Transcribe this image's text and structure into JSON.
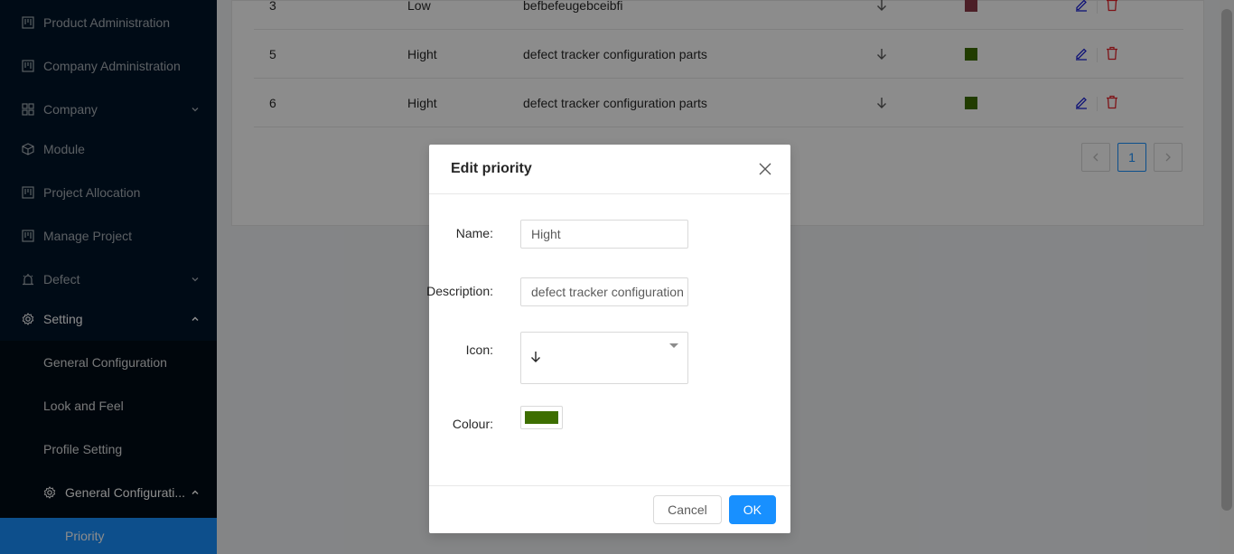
{
  "sidebar": {
    "items": [
      {
        "label": "Product Administration",
        "icon": "project-icon"
      },
      {
        "label": "Company Administration",
        "icon": "project-icon"
      },
      {
        "label": "Company",
        "icon": "appstore-icon",
        "expandable": true
      },
      {
        "label": "Module",
        "icon": "code-sandbox-icon"
      },
      {
        "label": "Project Allocation",
        "icon": "project-icon"
      },
      {
        "label": "Manage Project",
        "icon": "project-icon"
      },
      {
        "label": "Defect",
        "icon": "alert-icon",
        "expandable": true
      },
      {
        "label": "Setting",
        "icon": "setting-icon",
        "expanded": true
      }
    ],
    "setting_children": [
      {
        "label": "General Configuration"
      },
      {
        "label": "Look and Feel"
      },
      {
        "label": "Profile Setting"
      }
    ],
    "general_config_submenu": {
      "label": "General Configurati...",
      "icon": "setting-icon"
    },
    "selected_item": {
      "label": "Priority"
    }
  },
  "table": {
    "rows": [
      {
        "id": "3",
        "name": "Low",
        "description": "befbefeugebceibfi",
        "icon": "arrow-down-icon",
        "colour": "#8b3a48"
      },
      {
        "id": "5",
        "name": "Hight",
        "description": "defect tracker configuration parts",
        "icon": "arrow-down-icon",
        "colour": "#3d6e00"
      },
      {
        "id": "6",
        "name": "Hight",
        "description": "defect tracker configuration parts",
        "icon": "arrow-down-icon",
        "colour": "#3d6e00"
      }
    ]
  },
  "pagination": {
    "current": "1",
    "prev_icon": "left-icon",
    "next_icon": "right-icon"
  },
  "modal": {
    "title": "Edit priority",
    "fields": {
      "name_label": "Name",
      "name_value": "Hight",
      "description_label": "Description",
      "description_value": "defect tracker configuration parts",
      "icon_label": "Icon",
      "icon_value": "arrow-down-icon",
      "colour_label": "Colour",
      "colour_value": "#3d6e00"
    },
    "cancel_label": "Cancel",
    "ok_label": "OK"
  },
  "colors": {
    "sidebar_bg": "#001529",
    "selected": "#1890ff",
    "edit_icon": "#1d23d9",
    "delete_icon": "#e5232b"
  }
}
